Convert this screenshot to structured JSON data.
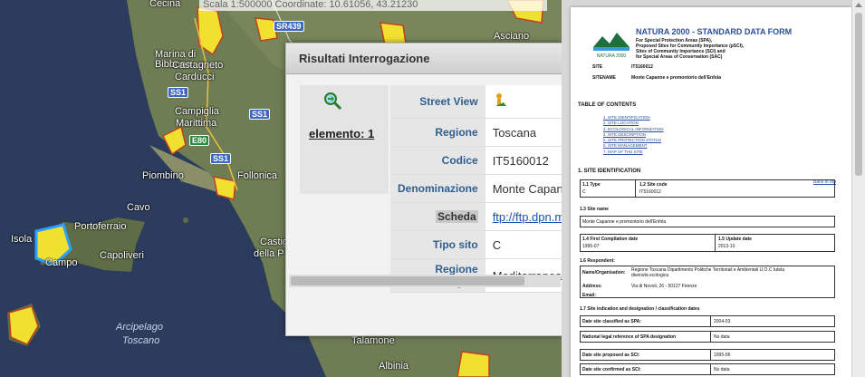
{
  "map": {
    "scale_text": "Scala 1:500000 Coordinate: 10.61056, 43.21230",
    "labels": [
      {
        "text": "Cecina"
      },
      {
        "text": "Marina di"
      },
      {
        "text": "Bibbona"
      },
      {
        "text": "Castagneto"
      },
      {
        "text": "Carducci"
      },
      {
        "text": "Campiglia"
      },
      {
        "text": "Marittima"
      },
      {
        "text": "Piombino"
      },
      {
        "text": "Follonica"
      },
      {
        "text": "Cavo"
      },
      {
        "text": "Portoferraio"
      },
      {
        "text": "Isola"
      },
      {
        "text": "Campo"
      },
      {
        "text": "Capoliveri"
      },
      {
        "text": "Arcipelago"
      },
      {
        "text": "Toscano"
      },
      {
        "text": "Asciano"
      },
      {
        "text": "Castig"
      },
      {
        "text": "della P"
      },
      {
        "text": "Talamone"
      },
      {
        "text": "Albinia"
      }
    ],
    "roads": [
      "SR439",
      "SS1",
      "SS1",
      "E80",
      "SS1"
    ]
  },
  "popup": {
    "title": "Risultati Interrogazione",
    "element_link": "elemento: 1",
    "rows": [
      {
        "key": "Street View",
        "value": ""
      },
      {
        "key": "Regione",
        "value": "Toscana"
      },
      {
        "key": "Codice",
        "value": "IT5160012"
      },
      {
        "key": "Denominazione",
        "value": "Monte Capanne e promontorio dell'Enfola"
      },
      {
        "key": "Scheda",
        "value": "ftp://ftp.dpn.minambiente.it"
      },
      {
        "key": "Tipo sito",
        "value": "C"
      },
      {
        "key": "Regione biologica",
        "value": "Mediterranea"
      }
    ]
  },
  "pdf": {
    "form_title": "NATURA 2000 - STANDARD DATA FORM",
    "subtitle_lines": [
      "For Special Protection Areas (SPA),",
      "Proposed Sites for Community Importance (pSCI),",
      "Sites of Community Importance (SCI) and",
      "for Special Areas of Conservation (SAC)"
    ],
    "logo_text": "NATURA 2000",
    "site_label": "SITE",
    "site_value": "IT5160012",
    "sitename_label": "SITENAME",
    "sitename_value": "Monte Capanne e promontorio dell'Enfola",
    "toc_title": "TABLE OF CONTENTS",
    "toc_items": [
      "1. SITE IDENTIFICATION",
      "2. SITE LOCATION",
      "3. ECOLOGICAL INFORMATION",
      "4. SITE DESCRIPTION",
      "5. SITE PROTECTION STATUS",
      "6. SITE MANAGEMENT",
      "7. MAP OF THE SITE"
    ],
    "section1_title": "1. SITE IDENTIFICATION",
    "back_to_top": "Back to top",
    "type_label": "1.1 Type",
    "type_value": "C",
    "code_label": "1.2 Site code",
    "code_value": "IT5160012",
    "sitename_section": "1.3 Site name",
    "sitename_full": "Monte Capanne e promontorio dell'Enfola",
    "first_compilation_label": "1.4 First Compilation date",
    "first_compilation_value": "1995-07",
    "update_label": "1.5 Update date",
    "update_value": "2013-10",
    "respondent_label": "1.6 Respondent:",
    "org_label": "Name/Organisation:",
    "org_value_1": "Regione Toscana Dipartimento Politiche Territoriali e Ambientali U.O.C tutela",
    "org_value_2": "diversità ecologica",
    "address_label": "Address:",
    "address_value": "Via di Novoli, 26 - 50127 Firenze",
    "email_label": "Email:",
    "designation_label": "1.7 Site indication and designation / classification dates",
    "spa_label": "Date site classified as SPA:",
    "spa_value": "2004-03",
    "legal_label": "National legal reference of SPA designation",
    "legal_value": "No data",
    "sci_prop_label": "Date site proposed as SCI:",
    "sci_prop_value": "1995-06",
    "sci_conf_label": "Date site confirmed as SCI:",
    "sci_conf_value": "No data"
  }
}
